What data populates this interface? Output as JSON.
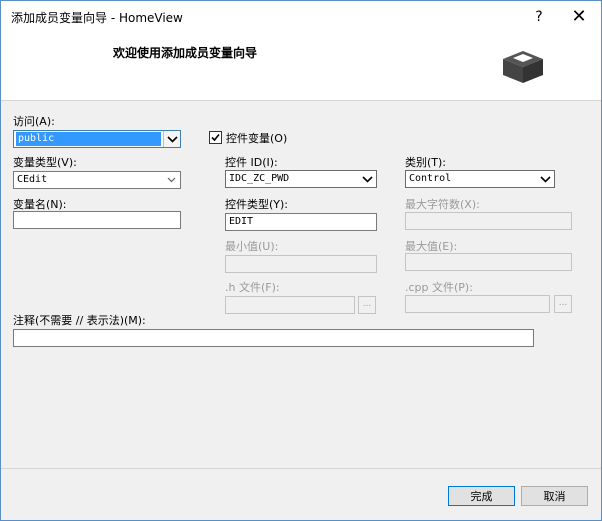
{
  "window": {
    "title": "添加成员变量向导 - HomeView",
    "help_glyph": "?",
    "close_glyph": "✕"
  },
  "header": {
    "title": "欢迎使用添加成员变量向导"
  },
  "form": {
    "access_label": "访问(A):",
    "access_value": "public",
    "control_var_label": "控件变量(O)",
    "control_var_checked": true,
    "var_type_label": "变量类型(V):",
    "var_type_value": "CEdit",
    "var_name_label": "变量名(N):",
    "var_name_value": "",
    "control_id_label": "控件 ID(I):",
    "control_id_value": "IDC_ZC_PWD",
    "control_type_label": "控件类型(Y):",
    "control_type_value": "EDIT",
    "min_label": "最小值(U):",
    "max_label": "最大值(E):",
    "h_file_label": ".h 文件(F):",
    "cpp_file_label": ".cpp 文件(P):",
    "category_label": "类别(T):",
    "category_value": "Control",
    "max_chars_label": "最大字符数(X):",
    "comment_label": "注释(不需要 // 表示法)(M):",
    "comment_value": "",
    "browse_glyph": "..."
  },
  "footer": {
    "finish_label": "完成",
    "cancel_label": "取消"
  }
}
